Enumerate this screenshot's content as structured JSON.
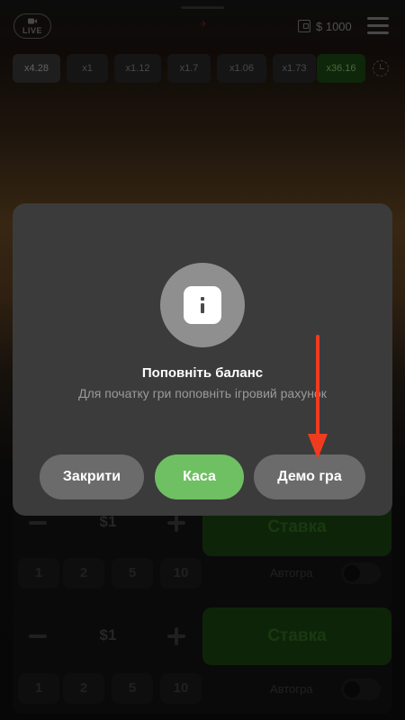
{
  "topbar": {
    "live_label": "LIVE",
    "balance": "$ 1000"
  },
  "history": {
    "items": [
      "x4.28",
      "x1",
      "x1.12",
      "x1.7",
      "x1.06",
      "x1.73",
      "x36.16"
    ]
  },
  "bet_panels": [
    {
      "minus": "−",
      "amount": "$1",
      "plus": "+",
      "stake_label": "Ставка",
      "quick_amounts": [
        "1",
        "2",
        "5",
        "10"
      ],
      "autoplay_label": "Автогра"
    },
    {
      "minus": "−",
      "amount": "$1",
      "plus": "+",
      "stake_label": "Ставка",
      "quick_amounts": [
        "1",
        "2",
        "5",
        "10"
      ],
      "autoplay_label": "Автогра"
    }
  ],
  "modal": {
    "title": "Поповніть баланс",
    "subtitle": "Для початку гри поповніть ігровий рахунок",
    "icon": "info-icon",
    "buttons": {
      "close": "Закрити",
      "cash": "Каса",
      "demo": "Демо гра"
    }
  },
  "colors": {
    "accent_green": "#6fc063",
    "modal_bg": "#3b3b3b",
    "annotation_red": "#f03c1e"
  }
}
